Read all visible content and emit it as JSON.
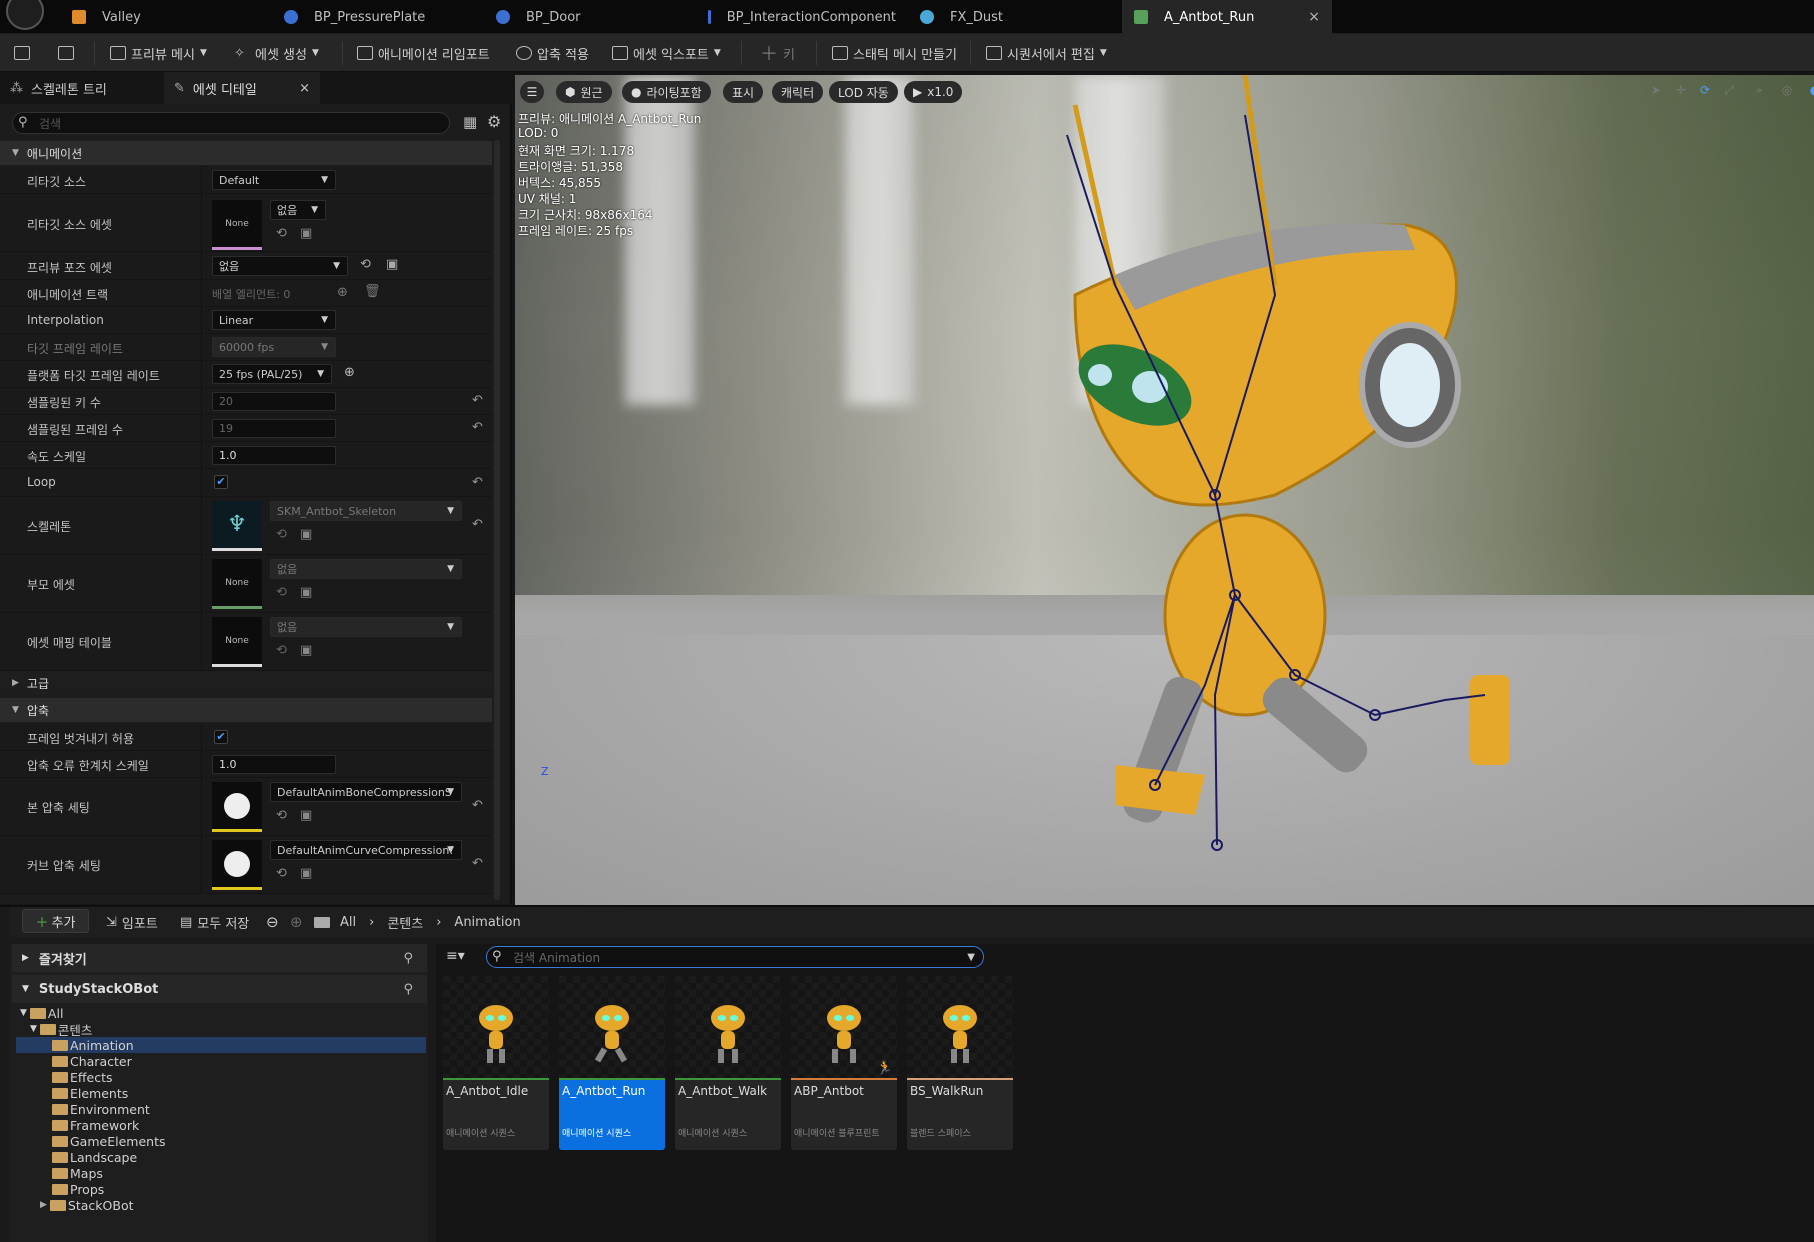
{
  "tabs": [
    {
      "label": "Valley",
      "color": "#e08a2b"
    },
    {
      "label": "BP_PressurePlate",
      "color": "#3b6fd4"
    },
    {
      "label": "BP_Door",
      "color": "#3b6fd4"
    },
    {
      "label": "BP_InteractionComponent",
      "color": "#3b6fd4"
    },
    {
      "label": "FX_Dust",
      "color": "#4aa8d8"
    },
    {
      "label": "A_Antbot_Run",
      "color": "#57a05a",
      "close": "×"
    }
  ],
  "toolbar": {
    "preview_mesh": "프리뷰 메시",
    "create_asset": "에셋 생성",
    "reimport": "애니메이션 리임포트",
    "apply_compression": "압축 적용",
    "export_asset": "에셋 익스포트",
    "key": "키",
    "make_static_mesh": "스태틱 메시 만들기",
    "edit_in_sequencer": "시퀀서에서 편집"
  },
  "left_panel": {
    "tabs": [
      "스켈레톤 트리",
      "에셋 디테일"
    ],
    "tab_close": "×",
    "search_placeholder": "검색",
    "cat_animation": "애니메이션",
    "cat_advanced": "고급",
    "cat_compression": "압축",
    "rows": {
      "retarget_source": {
        "label": "리타깃 소스",
        "value": "Default"
      },
      "retarget_source_asset": {
        "label": "리타깃 소스 에셋",
        "thumb": "None",
        "value": "없음"
      },
      "preview_pose_asset": {
        "label": "프리뷰 포즈 에셋",
        "value": "없음"
      },
      "anim_track": {
        "label": "애니메이션 트랙",
        "value": "배열 엘리먼트: 0"
      },
      "interpolation": {
        "label": "Interpolation",
        "value": "Linear"
      },
      "target_frame_rate": {
        "label": "타깃 프레임 레이트",
        "value": "60000 fps"
      },
      "platform_target_frame_rate": {
        "label": "플랫폼 타깃 프레임 레이트",
        "value": "25 fps (PAL/25)"
      },
      "sampled_keys": {
        "label": "샘플링된 키 수",
        "value": "20"
      },
      "sampled_frames": {
        "label": "샘플링된 프레임 수",
        "value": "19"
      },
      "rate_scale": {
        "label": "속도 스케일",
        "value": "1.0"
      },
      "loop": {
        "label": "Loop",
        "checked": true
      },
      "skeleton": {
        "label": "스켈레톤",
        "value": "SKM_Antbot_Skeleton"
      },
      "parent_asset": {
        "label": "부모 에셋",
        "thumb": "None",
        "value": "없음"
      },
      "asset_mapping_table": {
        "label": "에셋 매핑 테이블",
        "thumb": "None",
        "value": "없음"
      },
      "allow_frame_stripping": {
        "label": "프레임 벗겨내기 허용",
        "checked": true
      },
      "compression_error_threshold": {
        "label": "압축 오류 한계치 스케일",
        "value": "1.0"
      },
      "bone_compression": {
        "label": "본 압축 세팅",
        "value": "DefaultAnimBoneCompressionS"
      },
      "curve_compression": {
        "label": "커브 압축 세팅",
        "value": "DefaultAnimCurveCompression!"
      }
    }
  },
  "viewport": {
    "buttons": [
      "원근",
      "라이팅포함",
      "표시",
      "캐릭터",
      "LOD 자동",
      "x1.0"
    ],
    "stats": [
      "프리뷰: 애니메이션 A_Antbot_Run",
      "LOD: 0",
      "현재 화면 크기: 1.178",
      "트라이앵글: 51,358",
      "버텍스: 45,855",
      "UV 채널: 1",
      "크기 근사치: 98x86x164",
      "프레임 레이트: 25 fps"
    ],
    "axis_label": "Z"
  },
  "content_browser": {
    "add": "추가",
    "import": "임포트",
    "save_all": "모두 저장",
    "breadcrumb": [
      "All",
      "콘텐츠",
      "Animation"
    ],
    "favorites": "즐겨찾기",
    "project": "StudyStackOBot",
    "tree": [
      "All",
      "콘텐츠",
      "Animation",
      "Character",
      "Effects",
      "Elements",
      "Environment",
      "Framework",
      "GameElements",
      "Landscape",
      "Maps",
      "Props",
      "StackOBot"
    ],
    "search_placeholder": "검색 Animation",
    "assets": [
      {
        "name": "A_Antbot_Idle",
        "type": "애니메이션 시퀀스"
      },
      {
        "name": "A_Antbot_Run",
        "type": "애니메이션 시퀀스"
      },
      {
        "name": "A_Antbot_Walk",
        "type": "애니메이션 시퀀스"
      },
      {
        "name": "ABP_Antbot",
        "type": "애니메이션 블루프린트"
      },
      {
        "name": "BS_WalkRun",
        "type": "블렌드 스페이스"
      }
    ]
  }
}
